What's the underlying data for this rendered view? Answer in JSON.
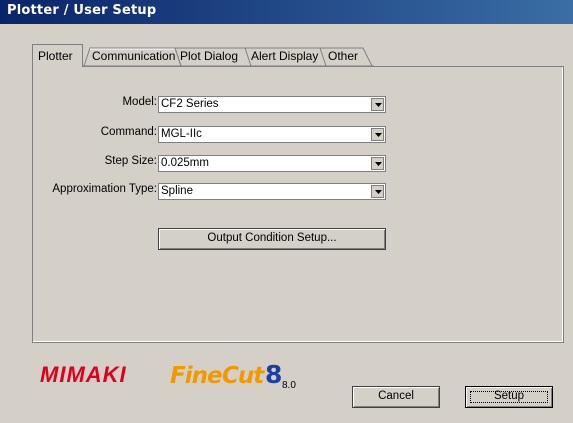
{
  "window": {
    "title": "Plotter / User Setup"
  },
  "tabs": [
    {
      "label": "Plotter",
      "active": true
    },
    {
      "label": "Communication",
      "active": false
    },
    {
      "label": "Plot Dialog",
      "active": false
    },
    {
      "label": "Alert Display",
      "active": false
    },
    {
      "label": "Other",
      "active": false
    }
  ],
  "form": {
    "model": {
      "label": "Model:",
      "value": "CF2 Series"
    },
    "command": {
      "label": "Command:",
      "value": "MGL-IIc"
    },
    "step_size": {
      "label": "Step Size:",
      "value": "0.025mm"
    },
    "approximation_type": {
      "label": "Approximation Type:",
      "value": "Spline"
    }
  },
  "buttons": {
    "output_condition": "Output Condition Setup...",
    "cancel": "Cancel",
    "setup": "Setup"
  },
  "footer": {
    "brand": "MIMAKI",
    "product": "FineCut8",
    "version": "8.0"
  },
  "colors": {
    "title_bar": "#0a246a",
    "dialog_face": "#d4d0c8",
    "brand_red": "#e0001b",
    "product_orange": "#f39800",
    "product_blue": "#1d3f9e"
  }
}
